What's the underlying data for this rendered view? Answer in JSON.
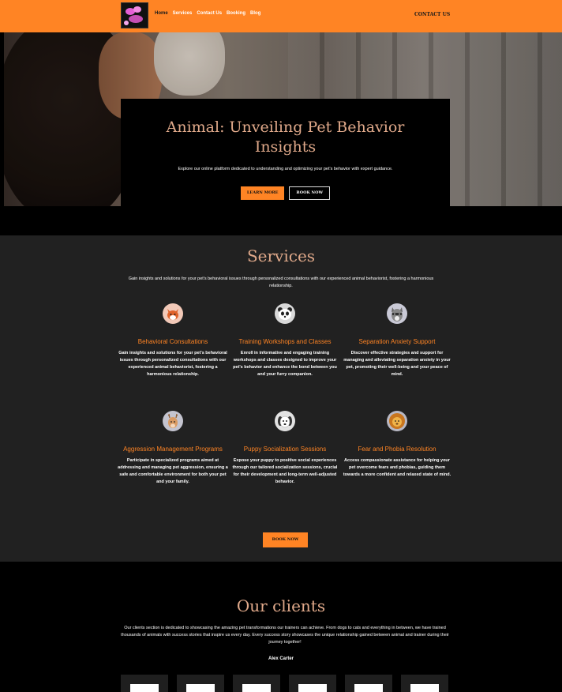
{
  "nav": {
    "links": [
      "Home",
      "Services",
      "Contact Us",
      "Booking",
      "Blog"
    ],
    "contact": "CONTACT US",
    "accent": "#ff8424"
  },
  "hero": {
    "title": "Animal: Unveiling Pet Behavior Insights",
    "subtitle": "Explore our online platform dedicated to understanding and optimizing your pet's behavior with expert guidance.",
    "learn_more": "LEARN MORE",
    "book_now": "BOOK NOW"
  },
  "services": {
    "title": "Services",
    "subtitle": "Gain insights and solutions for your pet's behavioral issues through personalized consultations with our experienced animal behaviorist, fostering a harmonious relationship.",
    "items": [
      {
        "icon": "fox-icon",
        "name": "Behavioral Consultations",
        "desc": "Gain insights and solutions for your pet's behavioral issues through personalized consultations with our experienced animal behaviorist, fostering a harmonious relationship."
      },
      {
        "icon": "panda-icon",
        "name": "Training Workshops and Classes",
        "desc": "Enroll in informative and engaging training workshops and classes designed to improve your pet's behavior and enhance the bond between you and your furry companion."
      },
      {
        "icon": "raccoon-icon",
        "name": "Separation Anxiety Support",
        "desc": "Discover effective strategies and support for managing and alleviating separation anxiety in your pet, promoting their well-being and your peace of mind."
      },
      {
        "icon": "deer-icon",
        "name": "Aggression Management Programs",
        "desc": "Participate in specialized programs aimed at addressing and managing pet aggression, ensuring a safe and comfortable environment for both your pet and your family."
      },
      {
        "icon": "puppy-icon",
        "name": "Puppy Socialization Sessions",
        "desc": "Expose your puppy to positive social experiences through our tailored socialization sessions, crucial for their development and long-term well-adjusted behavior."
      },
      {
        "icon": "lion-icon",
        "name": "Fear and Phobia Resolution",
        "desc": "Access compassionate assistance for helping your pet overcome fears and phobias, guiding them towards a more confident and relaxed state of mind."
      }
    ],
    "book_now": "BOOK NOW"
  },
  "clients": {
    "title": "Our clients",
    "subtitle": "Our clients section is dedicated to showcasing the amazing pet transformations our trainers can achieve. From dogs to cats and everything in between, we have trained thousands of animals with success stories that inspire us every day. Every success story showcases the unique relationship gained between animal and trainer during their journey together!",
    "name": "Alex Carter"
  }
}
